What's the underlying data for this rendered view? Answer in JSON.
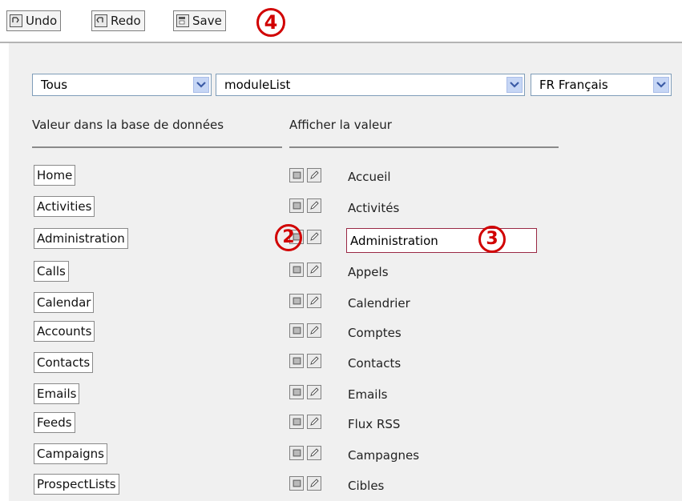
{
  "toolbar": {
    "undo_label": "Undo",
    "redo_label": "Redo",
    "save_label": "Save",
    "marker_4": "4"
  },
  "filters": {
    "category": "Tous",
    "dropdown": "moduleList",
    "language": "FR Français"
  },
  "columns": {
    "db_value": "Valeur dans la base de données",
    "display_value": "Afficher la valeur"
  },
  "rows": [
    {
      "key": "Home",
      "value": "Accueil"
    },
    {
      "key": "Activities",
      "value": "Activités"
    },
    {
      "key": "Administration",
      "value": "Administration"
    },
    {
      "key": "Calls",
      "value": "Appels"
    },
    {
      "key": "Calendar",
      "value": "Calendrier"
    },
    {
      "key": "Accounts",
      "value": "Comptes"
    },
    {
      "key": "Contacts",
      "value": "Contacts"
    },
    {
      "key": "Emails",
      "value": "Emails"
    },
    {
      "key": "Feeds",
      "value": "Flux RSS"
    },
    {
      "key": "Campaigns",
      "value": "Campagnes"
    },
    {
      "key": "ProspectLists",
      "value": "Cibles"
    }
  ],
  "markers": {
    "m2": "2",
    "m3": "3"
  },
  "colors": {
    "marker": "#d10000",
    "edit_border": "#9a2945",
    "panel": "#f0f0f0"
  }
}
